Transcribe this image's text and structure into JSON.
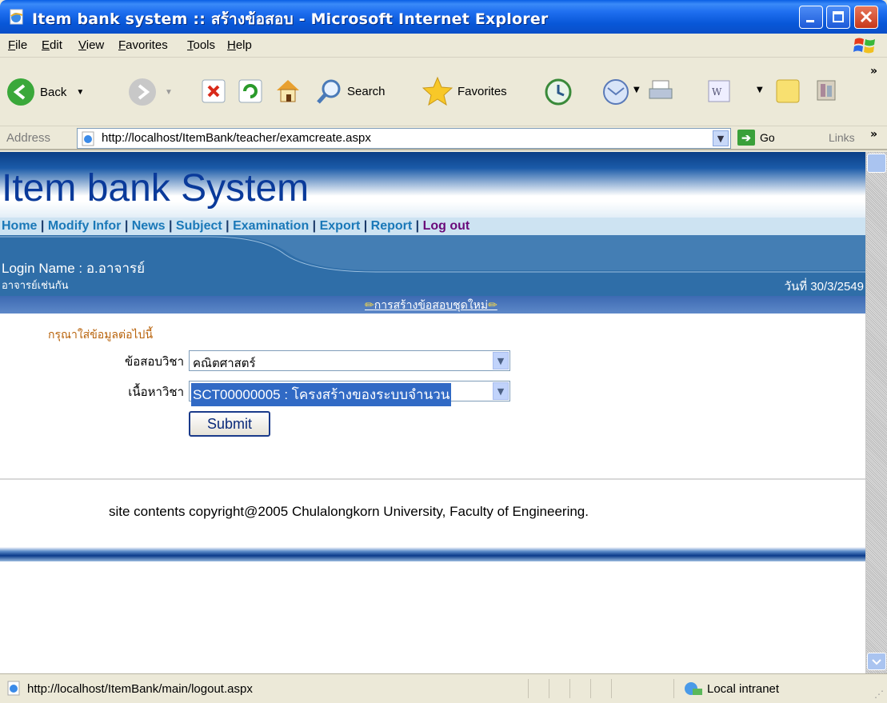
{
  "window": {
    "title": "Item bank system :: สร้างข้อสอบ - Microsoft Internet Explorer"
  },
  "menubar": {
    "items": [
      "File",
      "Edit",
      "View",
      "Favorites",
      "Tools",
      "Help"
    ]
  },
  "toolbar": {
    "back": "Back",
    "search": "Search",
    "favorites": "Favorites"
  },
  "addressbar": {
    "label": "Address",
    "url": "http://localhost/ItemBank/teacher/examcreate.aspx",
    "go": "Go",
    "links": "Links"
  },
  "page": {
    "title": "Item bank System",
    "nav": [
      "Home",
      "Modify Infor",
      "News",
      "Subject",
      "Examination",
      "Export",
      "Report",
      "Log out"
    ],
    "login_label": "Login Name : อ.อาจารย์",
    "login_sub": "อาจารย์เช่นกัน",
    "date": "วันที่ 30/3/2549",
    "section_title": "การสร้างข้อสอบชุดใหม่",
    "instruction": "กรุณาใส่ข้อมูลต่อไปนี้",
    "form": {
      "subject_label": "ข้อสอบวิชา",
      "subject_value": "คณิตศาสตร์",
      "content_label": "เนื้อหาวิชา",
      "content_value": "SCT00000005 : โครงสร้างของระบบจำนวน",
      "submit": "Submit"
    },
    "copyright": "site contents copyright@2005 Chulalongkorn University, Faculty of Engineering."
  },
  "statusbar": {
    "url": "http://localhost/ItemBank/main/logout.aspx",
    "zone": "Local intranet"
  }
}
